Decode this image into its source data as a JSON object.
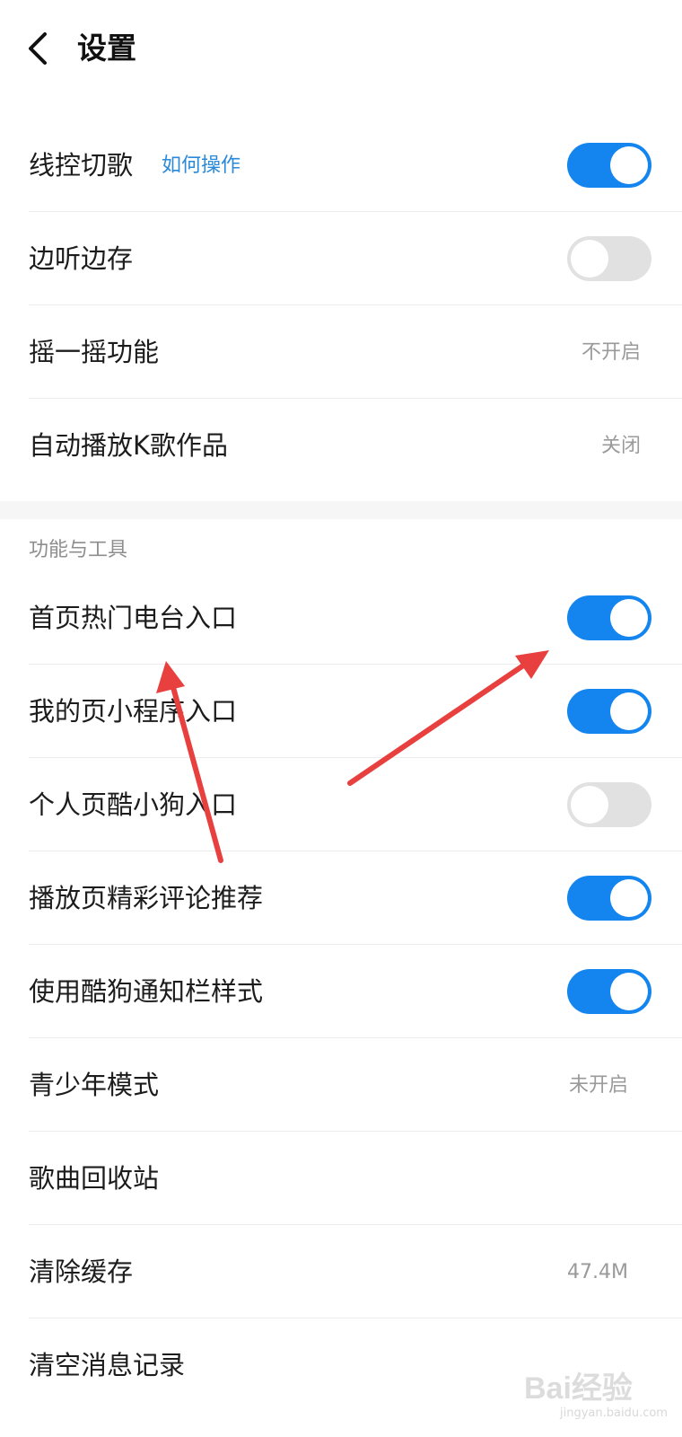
{
  "header": {
    "title": "设置"
  },
  "settings_top": [
    {
      "label": "线控切歌",
      "link": "如何操作",
      "control": "toggle",
      "on": true
    },
    {
      "label": "边听边存",
      "control": "toggle",
      "on": false
    },
    {
      "label": "摇一摇功能",
      "control": "value",
      "value": "不开启"
    },
    {
      "label": "自动播放K歌作品",
      "control": "value",
      "value": "关闭"
    }
  ],
  "section": {
    "title": "功能与工具"
  },
  "settings_tools": [
    {
      "label": "首页热门电台入口",
      "control": "toggle",
      "on": true
    },
    {
      "label": "我的页小程序入口",
      "control": "toggle",
      "on": true
    },
    {
      "label": "个人页酷小狗入口",
      "control": "toggle",
      "on": false
    },
    {
      "label": "播放页精彩评论推荐",
      "control": "toggle",
      "on": true
    },
    {
      "label": "使用酷狗通知栏样式",
      "control": "toggle",
      "on": true
    },
    {
      "label": "青少年模式",
      "control": "value",
      "value": "未开启"
    },
    {
      "label": "歌曲回收站",
      "control": "none"
    },
    {
      "label": "清除缓存",
      "control": "value",
      "value": "47.4M"
    },
    {
      "label": "清空消息记录",
      "control": "none"
    }
  ],
  "watermark": {
    "mark": "Bai经验",
    "site": "jingyan.baidu.com"
  },
  "colors": {
    "accent": "#1485ee",
    "annotation_arrow": "#e8403f",
    "link": "#2a8ad9"
  }
}
